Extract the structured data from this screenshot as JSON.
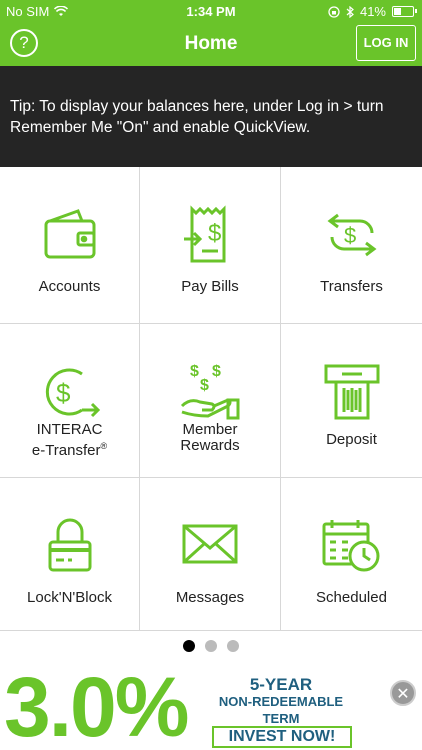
{
  "status_bar": {
    "carrier": "No SIM",
    "time": "1:34 PM",
    "battery_label": "41%",
    "battery_level": 0.41,
    "wifi_icon": "wifi-icon",
    "bluetooth_icon": "bluetooth-icon",
    "lock_icon": "orientation-lock-icon"
  },
  "nav": {
    "title": "Home",
    "help_label": "?",
    "login_label": "LOG IN"
  },
  "tip": {
    "text": "Tip: To display your balances here, under Log in > turn Remember Me \"On\" and enable QuickView."
  },
  "tiles": [
    {
      "label": "Accounts",
      "icon": "wallet-icon"
    },
    {
      "label": "Pay Bills",
      "icon": "bill-icon"
    },
    {
      "label": "Transfers",
      "icon": "transfer-icon"
    },
    {
      "label_line1": "INTERAC",
      "label_line2": "e-Transfer",
      "label_sup": "®",
      "icon": "e-transfer-icon"
    },
    {
      "label_line1": "Member",
      "label_line2": "Rewards",
      "icon": "rewards-icon"
    },
    {
      "label": "Deposit",
      "icon": "atm-deposit-icon"
    },
    {
      "label": "Lock'N'Block",
      "icon": "card-lock-icon"
    },
    {
      "label": "Messages",
      "icon": "envelope-icon"
    },
    {
      "label": "Scheduled",
      "icon": "calendar-clock-icon"
    }
  ],
  "pager": {
    "count": 3,
    "active_index": 0
  },
  "ad": {
    "rate": "3.0%",
    "term_line1": "5-YEAR",
    "term_line2": "NON-REDEEMABLE",
    "term_line3": "TERM",
    "cta": "INVEST NOW!",
    "close_label": "✕"
  },
  "colors": {
    "brand_green": "#6ac42a",
    "tip_background": "#252525",
    "ad_text_blue": "#1f5f7f"
  }
}
